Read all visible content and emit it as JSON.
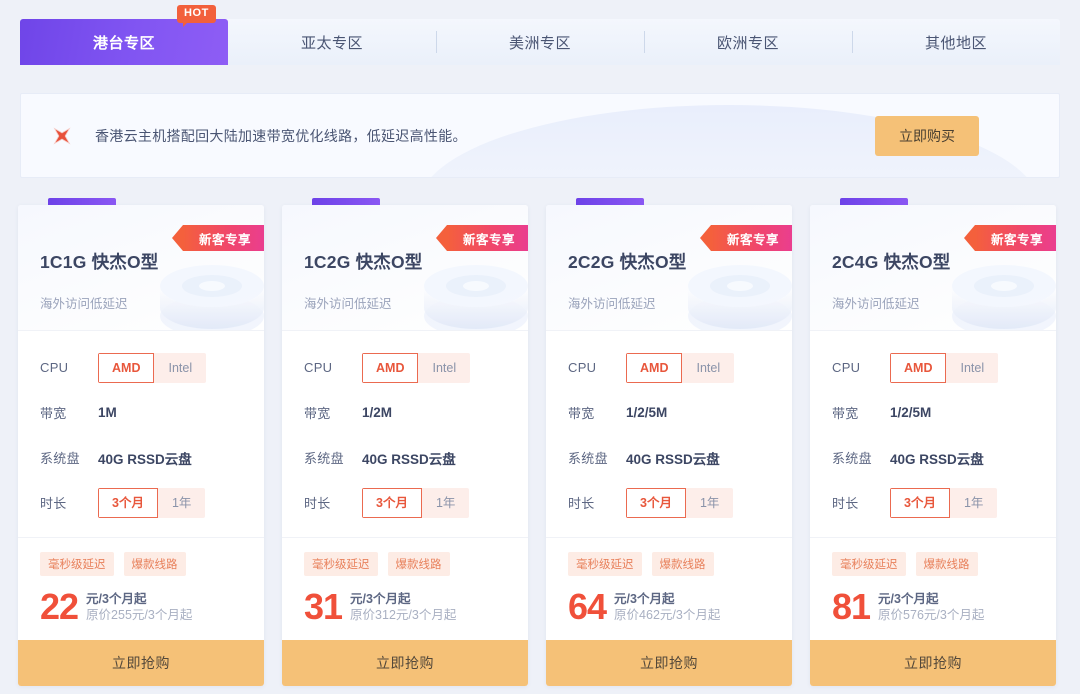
{
  "tabs": [
    {
      "label": "港台专区",
      "active": true,
      "badge": "HOT"
    },
    {
      "label": "亚太专区",
      "active": false,
      "badge": ""
    },
    {
      "label": "美洲专区",
      "active": false,
      "badge": ""
    },
    {
      "label": "欧洲专区",
      "active": false,
      "badge": ""
    },
    {
      "label": "其他地区",
      "active": false,
      "badge": ""
    }
  ],
  "banner": {
    "icon": "spark-star-icon",
    "text": "香港云主机搭配回大陆加速带宽优化线路，低延迟高性能。",
    "button_label": "立即购买"
  },
  "cards": [
    {
      "ribbon": "新客专享",
      "title": "1C1G 快杰O型",
      "subtitle": "海外访问低延迟",
      "cpu_label": "CPU",
      "cpu_options": [
        "AMD",
        "Intel"
      ],
      "cpu_selected": "AMD",
      "bandwidth_label": "带宽",
      "bandwidth_value": "1M",
      "disk_label": "系统盘",
      "disk_value": "40G RSSD云盘",
      "duration_label": "时长",
      "duration_options": [
        "3个月",
        "1年"
      ],
      "duration_selected": "3个月",
      "tags": [
        "毫秒级延迟",
        "爆款线路"
      ],
      "price": "22",
      "price_unit": "元/3个月起",
      "price_original": "原价255元/3个月起",
      "button_label": "立即抢购"
    },
    {
      "ribbon": "新客专享",
      "title": "1C2G 快杰O型",
      "subtitle": "海外访问低延迟",
      "cpu_label": "CPU",
      "cpu_options": [
        "AMD",
        "Intel"
      ],
      "cpu_selected": "AMD",
      "bandwidth_label": "带宽",
      "bandwidth_value": "1/2M",
      "disk_label": "系统盘",
      "disk_value": "40G RSSD云盘",
      "duration_label": "时长",
      "duration_options": [
        "3个月",
        "1年"
      ],
      "duration_selected": "3个月",
      "tags": [
        "毫秒级延迟",
        "爆款线路"
      ],
      "price": "31",
      "price_unit": "元/3个月起",
      "price_original": "原价312元/3个月起",
      "button_label": "立即抢购"
    },
    {
      "ribbon": "新客专享",
      "title": "2C2G 快杰O型",
      "subtitle": "海外访问低延迟",
      "cpu_label": "CPU",
      "cpu_options": [
        "AMD",
        "Intel"
      ],
      "cpu_selected": "AMD",
      "bandwidth_label": "带宽",
      "bandwidth_value": "1/2/5M",
      "disk_label": "系统盘",
      "disk_value": "40G RSSD云盘",
      "duration_label": "时长",
      "duration_options": [
        "3个月",
        "1年"
      ],
      "duration_selected": "3个月",
      "tags": [
        "毫秒级延迟",
        "爆款线路"
      ],
      "price": "64",
      "price_unit": "元/3个月起",
      "price_original": "原价462元/3个月起",
      "button_label": "立即抢购"
    },
    {
      "ribbon": "新客专享",
      "title": "2C4G 快杰O型",
      "subtitle": "海外访问低延迟",
      "cpu_label": "CPU",
      "cpu_options": [
        "AMD",
        "Intel"
      ],
      "cpu_selected": "AMD",
      "bandwidth_label": "带宽",
      "bandwidth_value": "1/2/5M",
      "disk_label": "系统盘",
      "disk_value": "40G RSSD云盘",
      "duration_label": "时长",
      "duration_options": [
        "3个月",
        "1年"
      ],
      "duration_selected": "3个月",
      "tags": [
        "毫秒级延迟",
        "爆款线路"
      ],
      "price": "81",
      "price_unit": "元/3个月起",
      "price_original": "原价576元/3个月起",
      "button_label": "立即抢购"
    }
  ],
  "colors": {
    "active_tab": "#7a4cef",
    "hot_badge": "#f2603c",
    "ribbon_start": "#f4603c",
    "ribbon_end": "#ea3e8f",
    "price": "#f0503a",
    "cta_button": "#f5c177",
    "card_accent": "#6d42e8",
    "page_background": "#eef1f8"
  }
}
